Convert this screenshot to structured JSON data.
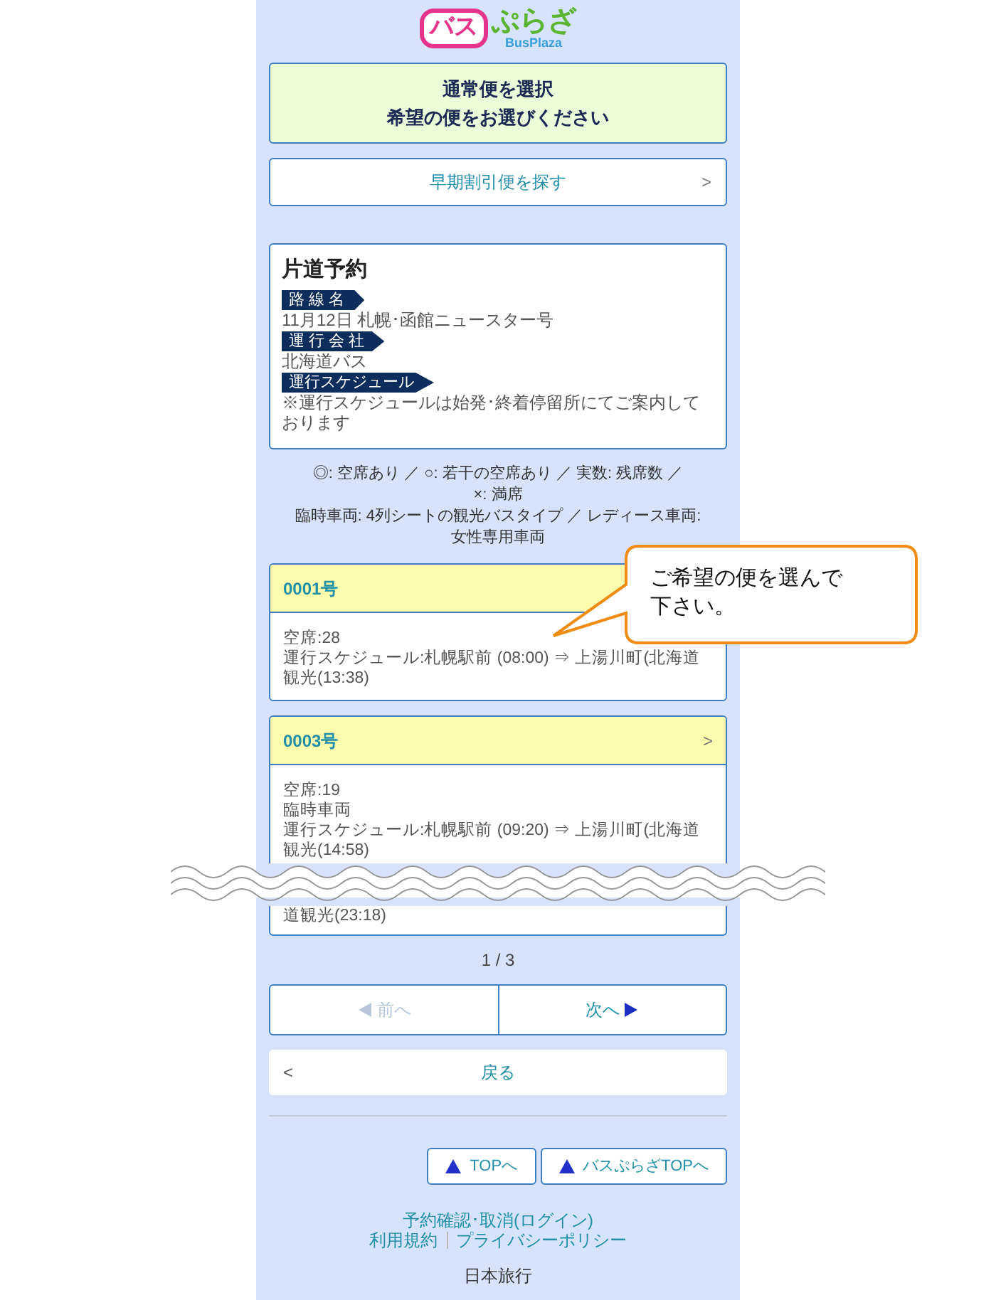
{
  "logo": {
    "bus": "バス",
    "plaza": "ぷらざ",
    "latin": "BusPlaza"
  },
  "heading": {
    "lines": [
      "通常便を選択",
      "希望の便をお選びください"
    ]
  },
  "early_button": {
    "label": "早期割引便を探す",
    "chevron": ">"
  },
  "booking": {
    "title": "片道予約",
    "fields": [
      {
        "label": "路 線 名",
        "value": "11月12日 札幌･函館ニュースター号"
      },
      {
        "label": "運 行 会 社",
        "value": "北海道バス"
      },
      {
        "label": "運行スケジュール",
        "value": "※運行スケジュールは始発･終着停留所にてご案内しております"
      }
    ]
  },
  "legend": [
    "◎: 空席あり ／ ○: 若干の空席あり ／ 実数: 残席数 ／",
    "×: 満席",
    "臨時車両: 4列シートの観光バスタイプ ／ レディース車両:",
    "女性専用車両"
  ],
  "departures": [
    {
      "number": "0001号",
      "lines": [
        "空席:28",
        "運行スケジュール:札幌駅前 (08:00) ⇒ 上湯川町(北海道観光(13:38)"
      ]
    },
    {
      "number": "0003号",
      "chevron": ">",
      "lines": [
        "空席:19",
        "臨時車両",
        "運行スケジュール:札幌駅前 (09:20) ⇒ 上湯川町(北海道観光(14:58)"
      ],
      "tail": "道観光(23:18)"
    }
  ],
  "page_indicator": "1 / 3",
  "pager": [
    {
      "label": "前へ",
      "kind": "prev",
      "disabled": true
    },
    {
      "label": "次へ",
      "kind": "next",
      "disabled": false
    }
  ],
  "back_button": {
    "chevron": "<",
    "label": "戻る"
  },
  "top_buttons": [
    "TOPへ",
    "バスぷらざTOPへ"
  ],
  "footer_links": [
    [
      "予約確認･取消(ログイン)"
    ],
    [
      "利用規約",
      "プライバシーポリシー"
    ]
  ],
  "company": "日本旅行",
  "callout": {
    "text": "ご希望の便を選んで下さい。"
  }
}
